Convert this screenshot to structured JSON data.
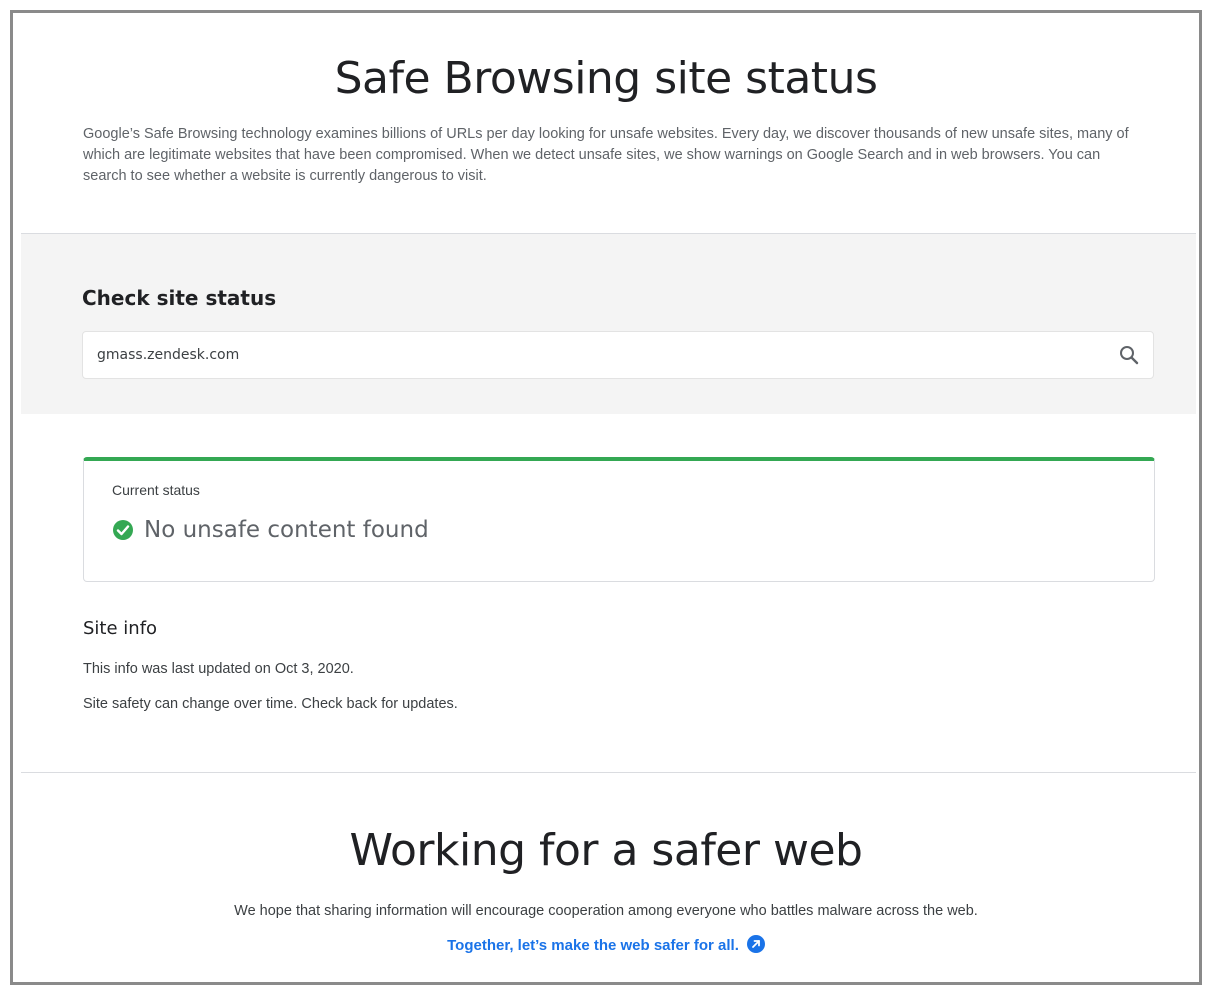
{
  "header": {
    "title": "Safe Browsing site status",
    "intro": "Google’s Safe Browsing technology examines billions of URLs per day looking for unsafe websites. Every day, we discover thousands of new unsafe sites, many of which are legitimate websites that have been compromised. When we detect unsafe sites, we show warnings on Google Search and in web browsers. You can search to see whether a website is currently dangerous to visit."
  },
  "search": {
    "heading": "Check site status",
    "value": "gmass.zendesk.com",
    "button_icon": "search-icon"
  },
  "status": {
    "label": "Current status",
    "result": "No unsafe content found",
    "icon": "check-circle-icon",
    "color": "#34a853"
  },
  "site_info": {
    "heading": "Site info",
    "updated": "This info was last updated on Oct 3, 2020.",
    "note": "Site safety can change over time. Check back for updates."
  },
  "footer": {
    "title": "Working for a safer web",
    "text": "We hope that sharing information will encourage cooperation among everyone who battles malware across the web.",
    "link_label": "Together, let’s make the web safer for all.",
    "link_icon": "external-link-icon",
    "link_color": "#1a73e8"
  }
}
